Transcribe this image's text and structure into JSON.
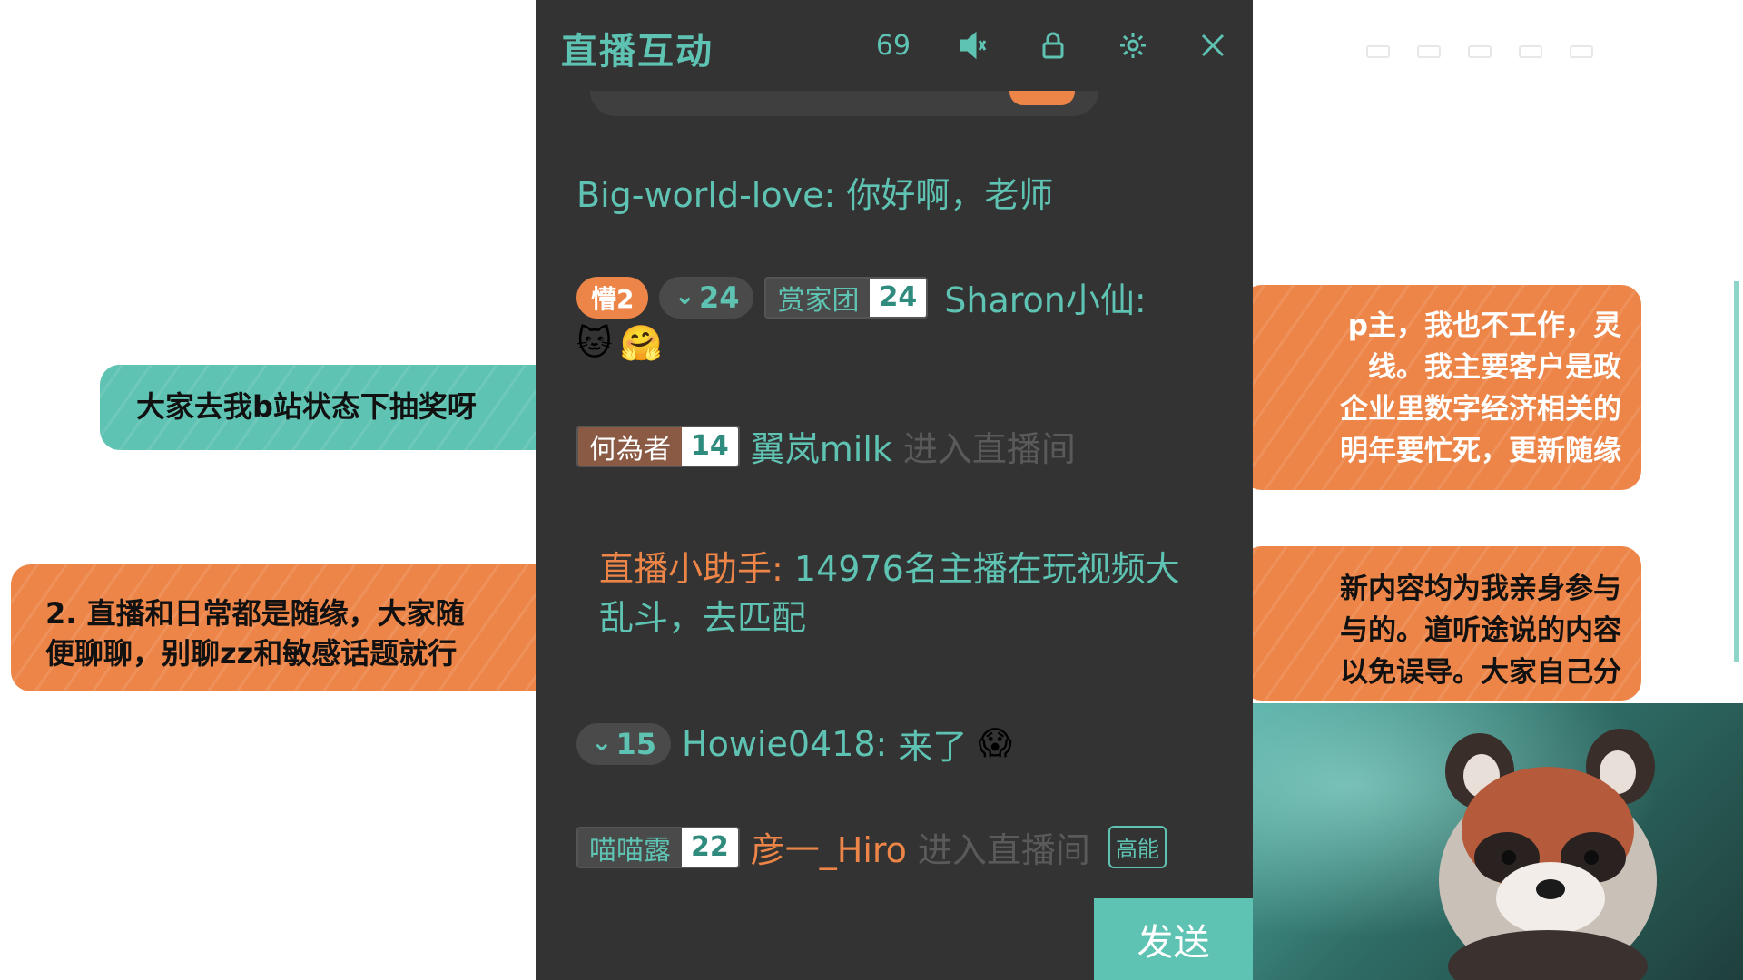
{
  "panel": {
    "title": "直播互动",
    "viewer_count": "69",
    "send_label": "发送"
  },
  "messages": {
    "hello": {
      "user": "Big-world-love:",
      "text": "你好啊，老师"
    },
    "sharon": {
      "fan_badge": "懵2",
      "guard_level": "24",
      "medal_name": "赏家团",
      "medal_level": "24",
      "user": "Sharon小仙:",
      "emojis": [
        "🐱",
        "🤗"
      ]
    },
    "milk": {
      "medal_name": "何為者",
      "medal_level": "14",
      "user": "翼岚milk",
      "action": "进入直播间"
    },
    "assistant": {
      "label": "直播小助手:",
      "text": "14976名主播在玩视频大乱斗，去匹配"
    },
    "howie": {
      "guard_level": "15",
      "user": "Howie0418:",
      "text": "来了",
      "emoji": "😱"
    },
    "hiro": {
      "medal_name": "喵喵露",
      "medal_level": "22",
      "user": "彦一_Hiro",
      "action": "进入直播间",
      "tag": "高能"
    }
  },
  "stickers": {
    "lottery": "大家去我b站状态下抽奖呀",
    "rules_line1": "2. 直播和日常都是随缘，大家随",
    "rules_line2": "便聊聊，别聊zz和敏感话题就行",
    "right1": [
      "p主，我也不工作，灵",
      "线。我主要客户是政",
      "企业里数字经济相关的",
      "明年要忙死，更新随缘"
    ],
    "right2": [
      "新内容均为我亲身参与",
      "与的。道听途说的内容",
      "以免误导。大家自己分"
    ]
  },
  "colors": {
    "teal": "#5ec3b2",
    "orange": "#ec8547",
    "panel_bg": "#333333"
  }
}
